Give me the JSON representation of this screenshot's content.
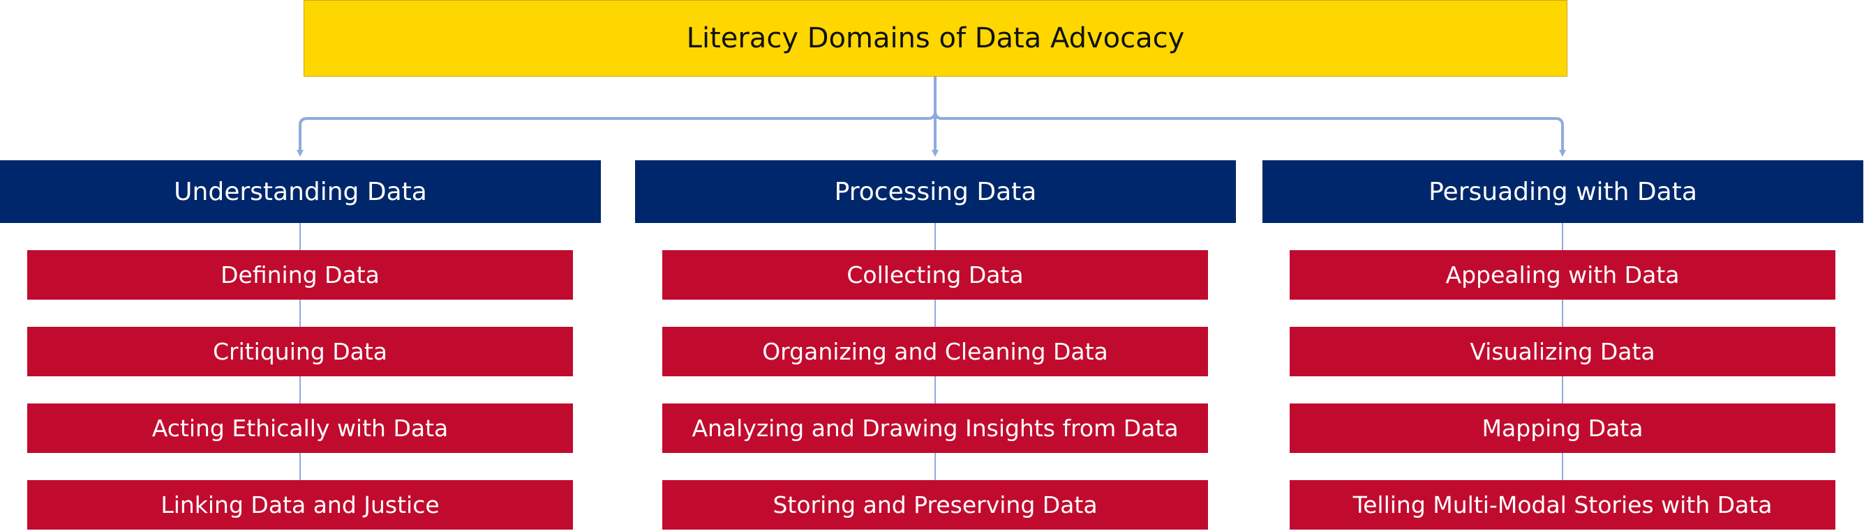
{
  "diagram": {
    "title": "Literacy Domains of Data Advocacy",
    "colors": {
      "root_fill": "#ffd700",
      "category_fill": "#00276b",
      "item_fill": "#c10b2e",
      "connector": "#8faadc"
    },
    "categories": [
      {
        "label": "Understanding Data",
        "items": [
          "Defining Data",
          "Critiquing Data",
          "Acting Ethically with Data",
          "Linking Data and Justice"
        ]
      },
      {
        "label": "Processing Data",
        "items": [
          "Collecting Data",
          "Organizing and Cleaning Data",
          "Analyzing and Drawing Insights from Data",
          "Storing and Preserving Data"
        ]
      },
      {
        "label": "Persuading with Data",
        "items": [
          "Appealing with Data",
          "Visualizing Data",
          "Mapping Data",
          "Telling Multi-Modal Stories with Data"
        ]
      }
    ]
  }
}
